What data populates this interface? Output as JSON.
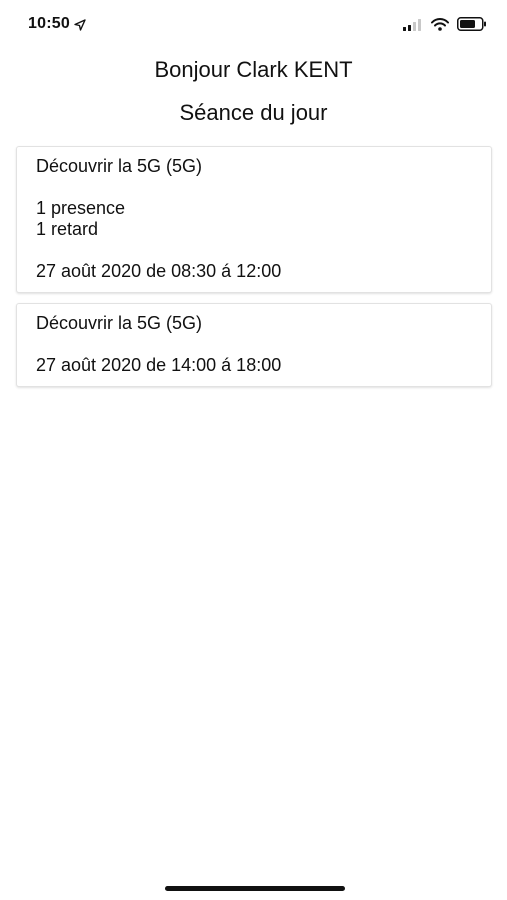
{
  "status_bar": {
    "time": "10:50",
    "icons": [
      "location-arrow-icon",
      "cellular-signal-icon",
      "wifi-icon",
      "battery-icon"
    ]
  },
  "header": {
    "greeting": "Bonjour Clark KENT",
    "title": "Séance du jour"
  },
  "sessions": [
    {
      "course": "Découvrir la 5G (5G)",
      "presence": "1 presence",
      "late": "1 retard",
      "schedule": "27 août 2020 de 08:30 á 12:00"
    },
    {
      "course": "Découvrir la 5G (5G)",
      "schedule": "27 août 2020 de 14:00 á 18:00"
    }
  ],
  "colors": {
    "text": "#111111",
    "card_border": "#e2e2e2",
    "background": "#ffffff"
  }
}
